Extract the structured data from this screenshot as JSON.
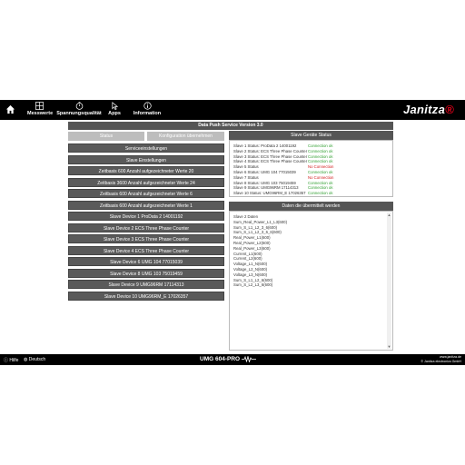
{
  "nav": {
    "items": [
      {
        "label": "Messwerte",
        "icon": "grid-icon"
      },
      {
        "label": "Spannungsqualität",
        "icon": "timer-icon"
      },
      {
        "label": "Apps",
        "icon": "cursor-icon"
      },
      {
        "label": "Information",
        "icon": "info-icon"
      }
    ],
    "brand": "Janitza",
    "brand_dot_color": "#e2001a"
  },
  "page": {
    "title": "Data Push Service Version 3.0",
    "tabs": [
      "Status",
      "Konfiguration übernehmen"
    ],
    "buttons": [
      "Serviceeinstellungen",
      "Slave Einstellungen",
      "Zeitbasis 600 Anzahl aufgezeichneter Werte 20",
      "Zeitbasis 3600 Anzahl aufgezeichneter Werte 24",
      "Zeitbasis 600 Anzahl aufgezeichneter Werte 6",
      "Zeitbasis 600 Anzahl aufgezeichneter Werte 1",
      "Slave Device 1 ProData 2 14001192",
      "Slave Device 2 ECS Three Phase Counter",
      "Slave Device 3 ECS Three Phase Counter",
      "Slave Device 4 ECS Three Phase Counter",
      "Slave Device 6 UMG 104 77015039",
      "Slave Device 8 UMG 103 75019459",
      "Slave Device 9 UMG96RM 17114313",
      "Slave Device 10 UMG96RM_E 17026357"
    ],
    "status_panel": {
      "title": "Slave Geräte Status",
      "rows": [
        {
          "label": "Slave 1 Status: ProData 2 14001192",
          "value": "Connection ok",
          "ok": true
        },
        {
          "label": "Slave 2 Status: ECS Three Phase Counter",
          "value": "Connection ok",
          "ok": true
        },
        {
          "label": "Slave 3 Status: ECS Three Phase Counter",
          "value": "Connection ok",
          "ok": true
        },
        {
          "label": "Slave 4 Status: ECS Three Phase Counter",
          "value": "Connection ok",
          "ok": true
        },
        {
          "label": "Slave 5 Status",
          "value": "No Connection",
          "ok": false
        },
        {
          "label": "Slave 6 Status: UMG 104 77015039",
          "value": "Connection ok",
          "ok": true
        },
        {
          "label": "Slave 7 Status",
          "value": "No Connection",
          "ok": false
        },
        {
          "label": "Slave 8 Status: UMG 103 75019459",
          "value": "Connection ok",
          "ok": true
        },
        {
          "label": "Slave 9 Status: UMG96RM 17114313",
          "value": "Connection ok",
          "ok": true
        },
        {
          "label": "Slave 10 Status: UMG96RM_E 17026357",
          "value": "Connection ok",
          "ok": true
        }
      ],
      "ok_color": "#2e9e2e",
      "error_color": "#d21a1a"
    },
    "data_panel": {
      "title": "Daten die übermittelt werden",
      "rows": [
        "Slave 2 Daten",
        "Sum_Real_Power_L1_L3(600)",
        "Sum_S_L1_L2_3_6(600)",
        "Sum_S_L1_L2_3_6_6(600)",
        "Real_Power_L1(600)",
        "Real_Power_L2(600)",
        "Real_Power_L3(600)",
        "Current_L1(600)",
        "Current_L2(600)",
        "Voltage_L1_N(600)",
        "Voltage_L2_N(600)",
        "Voltage_L3_N(600)",
        "Sum_S_L1_L2_6(600)",
        "Sum_S_L2_L3_6(600)"
      ]
    }
  },
  "footer": {
    "help": "Hilfe",
    "language": "Deutsch",
    "device": "UMG 604-PRO",
    "website": "www.janitza.de",
    "copyright": "© Janitza electronics GmbH"
  }
}
